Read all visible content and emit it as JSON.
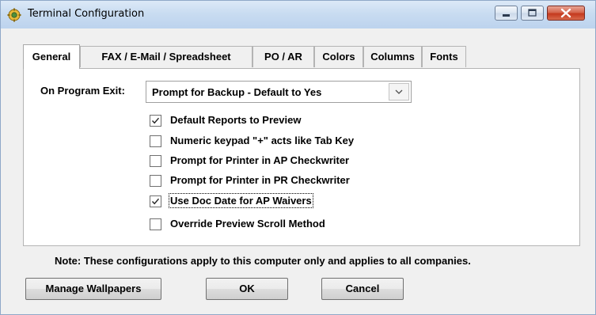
{
  "window": {
    "title": "Terminal Configuration",
    "icon": "app-gear-icon",
    "controls": [
      "minimize-icon",
      "maximize-icon",
      "close-icon"
    ]
  },
  "tabs": [
    {
      "label": "General",
      "active": true
    },
    {
      "label": "FAX / E-Mail / Spreadsheet",
      "active": false
    },
    {
      "label": "PO / AR",
      "active": false
    },
    {
      "label": "Colors",
      "active": false
    },
    {
      "label": "Columns",
      "active": false
    },
    {
      "label": "Fonts",
      "active": false
    }
  ],
  "general": {
    "on_exit_label": "On Program Exit:",
    "on_exit_value": "Prompt for Backup - Default to Yes",
    "options": [
      {
        "label": "Default Reports to Preview",
        "checked": true
      },
      {
        "label": "Numeric keypad \"+\" acts like Tab Key",
        "checked": false
      },
      {
        "label": "Prompt for Printer in AP Checkwriter",
        "checked": false
      },
      {
        "label": "Prompt for Printer in PR Checkwriter",
        "checked": false
      },
      {
        "label": "Use Doc Date for AP Waivers",
        "checked": true,
        "focused": true
      },
      {
        "label": "Override Preview Scroll Method",
        "checked": false
      }
    ]
  },
  "note": "Note:  These configurations apply to this computer only and applies to all companies.",
  "buttons": {
    "manage_wallpapers": "Manage Wallpapers",
    "ok": "OK",
    "cancel": "Cancel"
  },
  "colors": {
    "titlebar": "#c9dcf1",
    "close_button": "#c4391e",
    "dialog_bg": "#f0f0f0",
    "panel_bg": "#ffffff"
  }
}
